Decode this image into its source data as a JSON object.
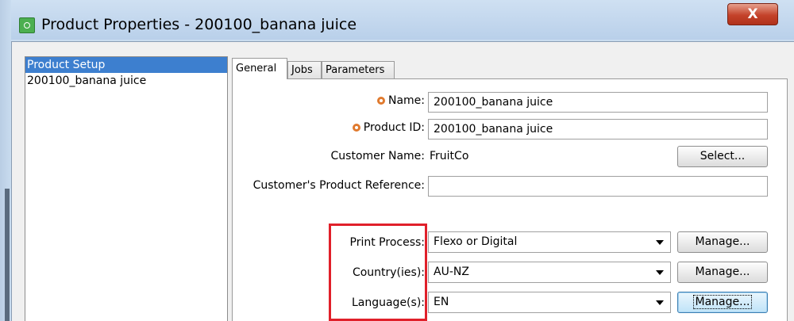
{
  "window": {
    "title": "Product Properties - 200100_banana juice",
    "close_label": "X"
  },
  "tree": {
    "items": [
      "Product Setup",
      "200100_banana juice"
    ]
  },
  "tabs": [
    "General",
    "Jobs",
    "Parameters"
  ],
  "form": {
    "name_label": "Name:",
    "name_value": "200100_banana juice",
    "product_id_label": "Product ID:",
    "product_id_value": "200100_banana juice",
    "customer_name_label": "Customer Name:",
    "customer_name_value": "FruitCo",
    "select_button": "Select...",
    "customer_ref_label": "Customer's Product Reference:",
    "customer_ref_value": "",
    "print_process_label": "Print Process:",
    "print_process_value": "Flexo or Digital",
    "countries_label": "Country(ies):",
    "countries_value": "AU-NZ",
    "languages_label": "Language(s):",
    "languages_value": "EN",
    "manage_button": "Manage..."
  },
  "colors": {
    "highlight": "#e0202a",
    "selection": "#3d7fcf",
    "required": "#e07a2e"
  }
}
